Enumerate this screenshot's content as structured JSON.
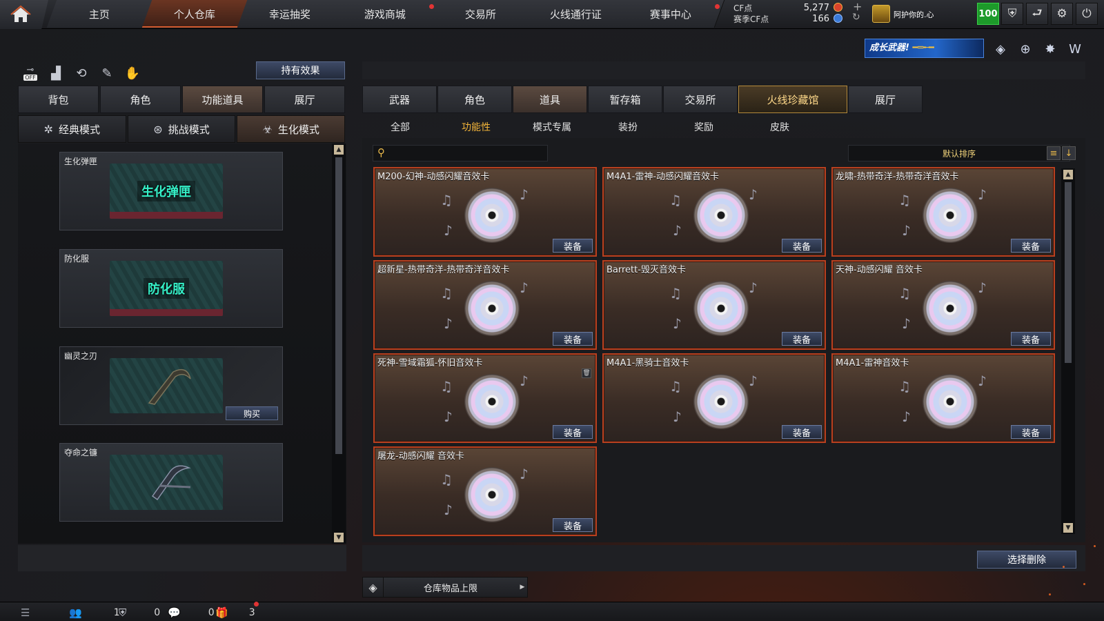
{
  "nav": {
    "tabs": [
      {
        "label": "主页",
        "active": false,
        "dot": false
      },
      {
        "label": "个人仓库",
        "active": true,
        "dot": false
      },
      {
        "label": "幸运抽奖",
        "active": false,
        "dot": false
      },
      {
        "label": "游戏商城",
        "active": false,
        "dot": true
      },
      {
        "label": "交易所",
        "active": false,
        "dot": false
      },
      {
        "label": "火线通行证",
        "active": false,
        "dot": false
      },
      {
        "label": "赛事中心",
        "active": false,
        "dot": true
      }
    ],
    "currency": {
      "cf_label": "CF点",
      "season_label": "赛季CF点",
      "cf_value": "5,277",
      "season_value": "166"
    },
    "user": {
      "name": "阿护你的.心",
      "level": "100"
    },
    "icons": [
      "shield-icon",
      "exit-icon",
      "gear-icon",
      "power-icon"
    ]
  },
  "promo": {
    "text": "成长武器!"
  },
  "left": {
    "hold_effect_label": "持有效果",
    "tabs": [
      {
        "label": "背包",
        "active": false
      },
      {
        "label": "角色",
        "active": false
      },
      {
        "label": "功能道具",
        "active": true
      },
      {
        "label": "展厅",
        "active": false
      }
    ],
    "modes": [
      {
        "label": "经典模式",
        "icon": "✲",
        "active": false
      },
      {
        "label": "挑战模式",
        "icon": "⊛",
        "active": false
      },
      {
        "label": "生化模式",
        "icon": "☣",
        "active": true
      }
    ],
    "toggle_label": "OFF",
    "items": [
      {
        "name": "生化弹匣",
        "image_text": "生化弹匣",
        "buy": ""
      },
      {
        "name": "防化服",
        "image_text": "防化服",
        "buy": ""
      },
      {
        "name": "幽灵之刃",
        "image_text": "",
        "buy": "购买"
      },
      {
        "name": "夺命之镰",
        "image_text": "",
        "buy": ""
      }
    ]
  },
  "right": {
    "categories": [
      {
        "label": "武器",
        "active": false
      },
      {
        "label": "角色",
        "active": false
      },
      {
        "label": "道具",
        "active": true
      },
      {
        "label": "暂存箱",
        "active": false
      },
      {
        "label": "交易所",
        "active": false
      },
      {
        "label": "火线珍藏馆",
        "special": true
      },
      {
        "label": "展厅",
        "active": false
      }
    ],
    "subtabs": [
      {
        "label": "全部",
        "active": false
      },
      {
        "label": "功能性",
        "active": true
      },
      {
        "label": "模式专属",
        "active": false
      },
      {
        "label": "装扮",
        "active": false
      },
      {
        "label": "奖励",
        "active": false
      },
      {
        "label": "皮肤",
        "active": false
      }
    ],
    "search": {
      "placeholder": ""
    },
    "sort_label": "默认排序",
    "equip_label": "装备",
    "cards": [
      {
        "name": "M200-幻神-动感闪耀音效卡",
        "trash": false
      },
      {
        "name": "M4A1-雷神-动感闪耀音效卡",
        "trash": false
      },
      {
        "name": "龙啸-热带奇洋-热带奇洋音效卡",
        "trash": false
      },
      {
        "name": "超新星-热带奇洋-热带奇洋音效卡",
        "trash": false
      },
      {
        "name": "Barrett-毁灭音效卡",
        "trash": false
      },
      {
        "name": "天神-动感闪耀 音效卡",
        "trash": false
      },
      {
        "name": "死神-雪域霜狐-怀旧音效卡",
        "trash": true
      },
      {
        "name": "M4A1-黑骑士音效卡",
        "trash": false
      },
      {
        "name": "M4A1-雷神音效卡",
        "trash": false
      },
      {
        "name": "屠龙-动感闪耀 音效卡",
        "trash": false
      }
    ],
    "select_delete_label": "选择删除",
    "capacity_label": "仓库物品上限"
  },
  "bottom": {
    "friends_count": "1",
    "clan_count": "0",
    "chat_count": "0",
    "gift_count": "3"
  },
  "colors": {
    "accent_orange": "#b8401f",
    "gold": "#f5b63a",
    "button_blue": "#3e4a66",
    "level_green": "#1d9a2a"
  }
}
